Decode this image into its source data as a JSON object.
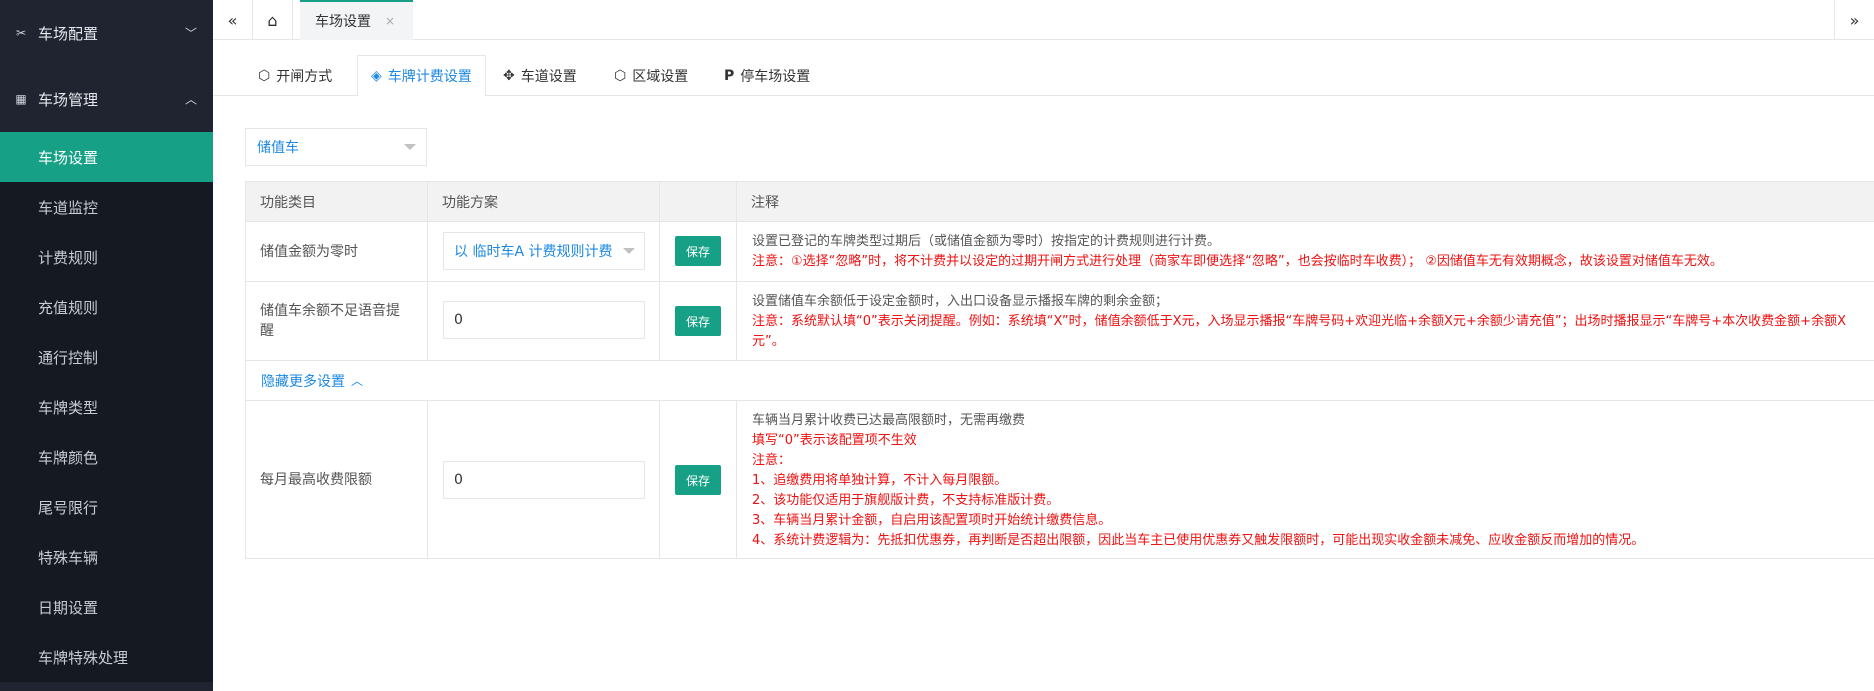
{
  "sidebar": {
    "groups": [
      {
        "label": "车场配置",
        "icon": "wrench-icon",
        "expanded": false
      },
      {
        "label": "车场管理",
        "icon": "apps-icon",
        "expanded": true
      }
    ],
    "items": [
      {
        "label": "车场设置",
        "active": true
      },
      {
        "label": "车道监控"
      },
      {
        "label": "计费规则"
      },
      {
        "label": "充值规则"
      },
      {
        "label": "通行控制"
      },
      {
        "label": "车牌类型"
      },
      {
        "label": "车牌颜色"
      },
      {
        "label": "尾号限行"
      },
      {
        "label": "特殊车辆"
      },
      {
        "label": "日期设置"
      },
      {
        "label": "车牌特殊处理"
      }
    ]
  },
  "topbar": {
    "open_tab": "车场设置",
    "close_glyph": "×"
  },
  "subtabs": [
    {
      "label": "开闸方式",
      "icon": "cube-icon"
    },
    {
      "label": "车牌计费设置",
      "icon": "layers-icon",
      "active": true
    },
    {
      "label": "车道设置",
      "icon": "move-icon"
    },
    {
      "label": "区域设置",
      "icon": "cube-icon"
    },
    {
      "label": "停车场设置",
      "icon": "parking-icon"
    }
  ],
  "vehicle_type": {
    "value": "储值车"
  },
  "table": {
    "headers": [
      "功能类目",
      "功能方案",
      "",
      "注释"
    ],
    "save_label": "保存",
    "rows": [
      {
        "label": "储值金额为零时",
        "select_value": "以 临时车A 计费规则计费",
        "note_gray": "设置已登记的车牌类型过期后（或储值金额为零时）按指定的计费规则进行计费。",
        "note_red": "注意：①选择“忽略”时，将不计费并以设定的过期开闸方式进行处理（商家车即便选择“忽略”，也会按临时车收费）；  ②因储值车无有效期概念，故该设置对储值车无效。"
      },
      {
        "label": "储值车余额不足语音提醒",
        "input_value": "0",
        "note_gray": "设置储值车余额低于设定金额时，入出口设备显示播报车牌的剩余金额；",
        "note_red": "注意：系统默认填“0”表示关闭提醒。例如：系统填“X”时，储值余额低于X元，入场显示播报“车牌号码+欢迎光临+余额X元+余额少请充值”；出场时播报显示“车牌号+本次收费金额+余额X元”。"
      }
    ],
    "toggle_label": "隐藏更多设置",
    "monthly": {
      "label": "每月最高收费限额",
      "input_value": "0",
      "note_gray": "车辆当月累计收费已达最高限额时，无需再缴费",
      "note_red_lines": [
        "填写“0”表示该配置项不生效",
        "注意：",
        "1、追缴费用将单独计算，不计入每月限额。",
        "2、该功能仅适用于旗舰版计费，不支持标准版计费。",
        "3、车辆当月累计金额，自启用该配置项时开始统计缴费信息。",
        "4、系统计费逻辑为：先抵扣优惠券，再判断是否超出限额，因此当车主已使用优惠券又触发限额时，可能出现实收金额未减免、应收金额反而增加的情况。"
      ]
    }
  },
  "colors": {
    "accent": "#16a085",
    "link": "#1e88e5",
    "sidebar": "#1f2430",
    "warning": "#ee1111"
  }
}
